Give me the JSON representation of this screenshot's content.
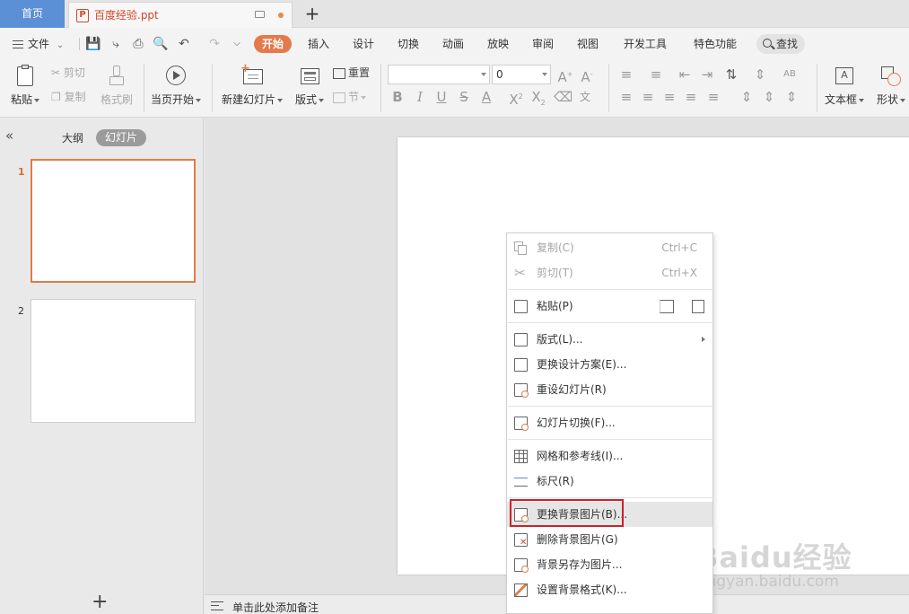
{
  "tabbar": {
    "home": "首页",
    "doc_title": "百度经验.ppt",
    "new_tab": "+"
  },
  "menubar": {
    "file": "文件",
    "tabs": [
      "开始",
      "插入",
      "设计",
      "切换",
      "动画",
      "放映",
      "审阅",
      "视图",
      "开发工具",
      "特色功能"
    ],
    "active_tab": "开始",
    "search": "查找"
  },
  "ribbon": {
    "paste": "粘贴",
    "cut": "剪切",
    "copy": "复制",
    "format_painter": "格式刷",
    "from_current": "当页开始",
    "new_slide": "新建幻灯片",
    "layout": "版式",
    "reset": "重置",
    "section": "节",
    "font_name": "",
    "font_size": "0",
    "textbox": "文本框",
    "shape": "形状"
  },
  "leftpanel": {
    "outline_tab": "大纲",
    "slides_tab": "幻灯片",
    "slides": [
      {
        "num": "1"
      },
      {
        "num": "2"
      }
    ],
    "add": "+"
  },
  "notes": {
    "placeholder": "单击此处添加备注"
  },
  "context_menu": {
    "copy": {
      "label": "复制(C)",
      "shortcut": "Ctrl+C"
    },
    "cut": {
      "label": "剪切(T)",
      "shortcut": "Ctrl+X"
    },
    "paste": {
      "label": "粘贴(P)"
    },
    "layout": {
      "label": "版式(L)..."
    },
    "change_design": {
      "label": "更换设计方案(E)..."
    },
    "reset_slide": {
      "label": "重设幻灯片(R)"
    },
    "transition": {
      "label": "幻灯片切换(F)..."
    },
    "grid": {
      "label": "网格和参考线(I)..."
    },
    "ruler": {
      "label": "标尺(R)"
    },
    "change_bg": {
      "label": "更换背景图片(B)..."
    },
    "delete_bg": {
      "label": "删除背景图片(G)"
    },
    "save_bg": {
      "label": "背景另存为图片..."
    },
    "bg_format": {
      "label": "设置背景格式(K)..."
    }
  },
  "colors": {
    "accent": "#e4794a",
    "home_tab": "#5b8fd6",
    "highlight_box": "#c8232c"
  },
  "watermark": {
    "brand": "Baidu经验",
    "url": "jingyan.baidu.com"
  }
}
